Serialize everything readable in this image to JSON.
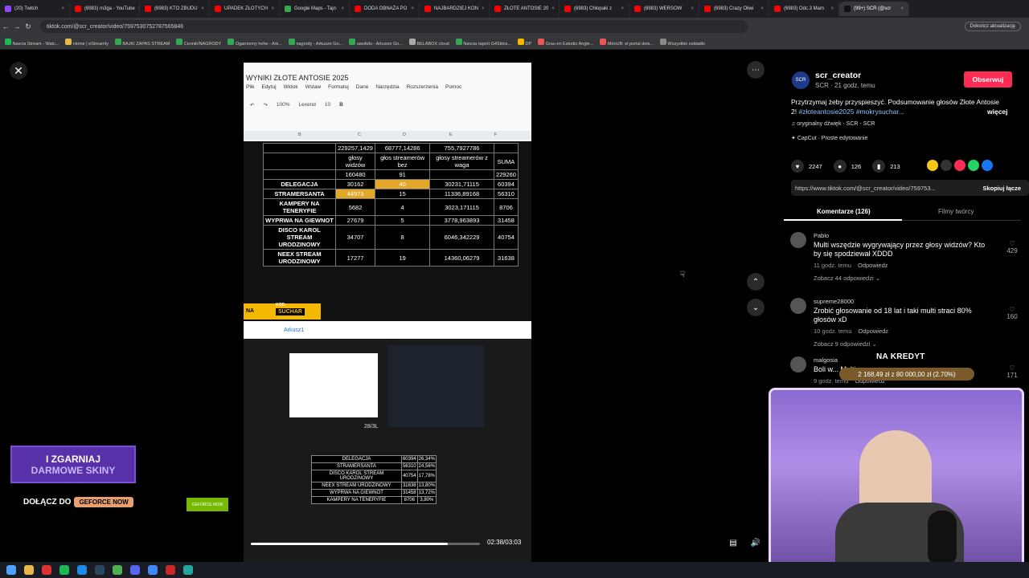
{
  "browser": {
    "tabs": [
      {
        "label": "(20) Twitch",
        "color": "#9146ff"
      },
      {
        "label": "(6983) m3ga - YouTube",
        "color": "#ff0000"
      },
      {
        "label": "(6983) KTO ZBUDU",
        "color": "#ff0000"
      },
      {
        "label": "UPADEK ZŁOTYCH",
        "color": "#ff0000"
      },
      {
        "label": "Google Maps - Tajn",
        "color": "#34a853"
      },
      {
        "label": "DODA OBNAŻA PO",
        "color": "#ff0000"
      },
      {
        "label": "NAJBARDZIEJ KON",
        "color": "#ff0000"
      },
      {
        "label": "ZŁOTE ANTOSIE 20",
        "color": "#ff0000"
      },
      {
        "label": "(6983) Chłopaki z",
        "color": "#ff0000"
      },
      {
        "label": "(6983) WERSOW",
        "color": "#ff0000"
      },
      {
        "label": "(6983) Crazy Oliwi",
        "color": "#ff0000"
      },
      {
        "label": "(6983) Odc.3 Mam",
        "color": "#ff0000"
      },
      {
        "label": "(99+) SCR (@scr",
        "color": "#111111"
      }
    ],
    "url": "tiktok.com/@scr_creator/video/7597530752787565846",
    "update_label": "Dokończ aktualizację",
    "bookmarks": [
      "Navcia Stream - Watc...",
      "Home | eStreamly",
      "BAJKI ZAPAS STREAM",
      "Cennik/NAGRODY",
      "Ogarniemy hehe - Ark...",
      "nagrody - Arkusze Go...",
      "uwufufu - Arkusze Go...",
      "BELABOX cloud",
      "Navcia raport G4Skins...",
      "DP",
      "Grau en Estudio Angle...",
      "MónUB: el portal dels...",
      "Wszystkie zakładki"
    ]
  },
  "video": {
    "sheet_title": "WYNIKI ZŁOTE ANTOSIE 2025",
    "menu": [
      "Plik",
      "Edytuj",
      "Widok",
      "Wstaw",
      "Formatuj",
      "Dane",
      "Narzędzia",
      "Rozszerzenia",
      "Pomoc"
    ],
    "zoom": "100%",
    "font": "Lexend",
    "font_size": "10",
    "columns": [
      "B",
      "C",
      "D",
      "E",
      "F"
    ],
    "totals": [
      "",
      "229257,1429",
      "68777,14286",
      "755,7927786",
      ""
    ],
    "headers": [
      "",
      "głosy widzów",
      "głos streamerów bez",
      "głosy streamerów z waga",
      "SUMA"
    ],
    "counts": [
      "",
      "160480",
      "91",
      "",
      "229260"
    ],
    "rows": [
      {
        "name": "DELEGACJA",
        "c": "30162",
        "d": "40",
        "e": "30231,71115",
        "f": "60394",
        "hl": "d"
      },
      {
        "name": "STRAMERSANTA",
        "c": "44973",
        "d": "15",
        "e": "11336,89168",
        "f": "56310",
        "hl": "c"
      },
      {
        "name": "KAMPERY NA TENERYFIE",
        "c": "5682",
        "d": "4",
        "e": "3023,171115",
        "f": "8706",
        "hl": ""
      },
      {
        "name": "WYPRWA NA GIEWNOT",
        "c": "27679",
        "d": "5",
        "e": "3778,963893",
        "f": "31458",
        "hl": ""
      },
      {
        "name": "DISCO KAROL STREAM URODZINOWY",
        "c": "34707",
        "d": "8",
        "e": "6046,342229",
        "f": "40754",
        "hl": ""
      },
      {
        "name": "NEEX STREAM URODZINOWY",
        "c": "17277",
        "d": "19",
        "e": "14360,06279",
        "f": "31638",
        "hl": ""
      }
    ],
    "kod_label": "KOD:",
    "kod_value": "SUCHAR",
    "kod_prefix": "NA",
    "sheet2_tab": "Arkusz1",
    "date_label": "28/3L",
    "summary": [
      {
        "name": "DELEGACJA",
        "value": "60394",
        "pct": "26,34%"
      },
      {
        "name": "STRAMERSANTA",
        "value": "56310",
        "pct": "24,56%"
      },
      {
        "name": "DISCO KAROL STREAM URODZINOWY",
        "value": "40754",
        "pct": "17,78%"
      },
      {
        "name": "NEEX STREAM URODZINOWY",
        "value": "31638",
        "pct": "13,80%"
      },
      {
        "name": "WYPRWA NA GIEWNOT",
        "value": "31458",
        "pct": "13,72%"
      },
      {
        "name": "KAMPERY NA TENERYFIE",
        "value": "8706",
        "pct": "3,80%"
      }
    ],
    "time": "02:38/03:03",
    "progress_fraction": 0.86
  },
  "panel": {
    "username": "scr_creator",
    "meta": "SCR · 21 godz. temu",
    "avatar_text": "SCR",
    "follow_label": "Obserwuj",
    "desc_text": "Przytrzymaj żeby przyspieszyć. Podsumowanie głosów Złote Antosie 2!",
    "desc_tags": "#złoteantosie2025 #mokrysuchar...",
    "more_label": "więcej",
    "sound": "oryginalny dźwięk - SCR - SCR",
    "capcut": "CapCut · Proste edytowanie",
    "likes": "2247",
    "comments_count": "126",
    "saves": "213",
    "share_colors": [
      "#f5c518",
      "#333333",
      "#fe2c55",
      "#25d366",
      "#1877f2",
      "#000000"
    ],
    "link": "https://www.tiktok.com/@scr_creator/video/759753...",
    "copy_label": "Skopiuj łącze",
    "tab_comments": "Komentarze (126)",
    "tab_creator": "Filmy twórcy",
    "comments": [
      {
        "user": "Pablo",
        "text": "Multi wszędzie wygrywający przez głosy widzów? Kto by się spodziewał XDDD",
        "time": "11 godz. temu",
        "reply": "Odpowiedz",
        "more": "Zobacz 44 odpowiedzi",
        "likes": "429"
      },
      {
        "user": "supreme28000",
        "text": "Zrobić głosowanie od 18 lat i taki multi straci 80% głosów xD",
        "time": "10 godz. temu",
        "reply": "Odpowiedz",
        "more": "Zobacz 9 odpowiedzi",
        "likes": "160"
      },
      {
        "user": "malgosia",
        "text": "Boli w... Multi co",
        "time": "9 godz. temu",
        "reply": "Odpowiedz",
        "more": "",
        "likes": "171"
      }
    ]
  },
  "overlay": {
    "kredyt": "NA KREDYT",
    "price": "2 168,49 zł z 80 000,00 zł (2.70%)",
    "promo1_line1": "I ZGARNIAJ",
    "promo1_line2": "DARMOWE SKINY",
    "promo2_text": "DOŁĄCZ DO",
    "promo2_badge": "GEFORCE NOW",
    "nvidia_label": "GEFORCE NOW"
  }
}
